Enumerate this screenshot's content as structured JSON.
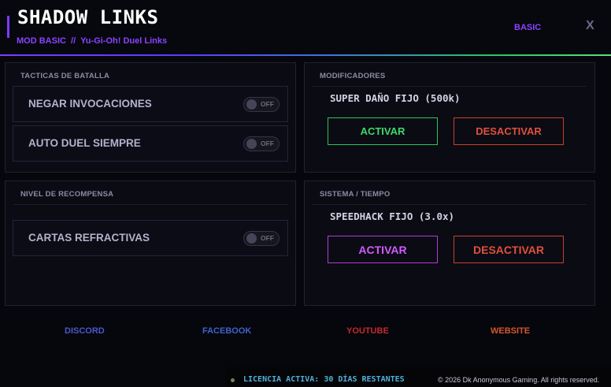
{
  "header": {
    "title": "SHADOW LINKS",
    "subtitle": "MOD BASIC  //  Yu-Gi-Oh! Duel Links",
    "mode": "BASIC",
    "close": "X"
  },
  "panels": {
    "battle": {
      "title": "TACTICAS DE BATALLA",
      "toggles": [
        {
          "label": "NEGAR INVOCACIONES",
          "state": "OFF"
        },
        {
          "label": "AUTO DUEL SIEMPRE",
          "state": "OFF"
        }
      ]
    },
    "modifiers": {
      "title": "MODIFICADORES",
      "item": "SUPER DAÑO FIJO (500k)",
      "activate": "ACTIVAR",
      "deactivate": "DESACTIVAR"
    },
    "reward": {
      "title": "NIVEL DE RECOMPENSA",
      "toggles": [
        {
          "label": "CARTAS REFRACTIVAS",
          "state": "OFF"
        }
      ]
    },
    "system": {
      "title": "SISTEMA / TIEMPO",
      "item": "SPEEDHACK FIJO (3.0x)",
      "activate": "ACTIVAR",
      "deactivate": "DESACTIVAR"
    }
  },
  "footer": {
    "links": [
      {
        "label": "DISCORD",
        "color": "#4c57c8"
      },
      {
        "label": "FACEBOOK",
        "color": "#3e63c9"
      },
      {
        "label": "YOUTUBE",
        "color": "#c42a2a"
      },
      {
        "label": "WEBSITE",
        "color": "#d6582a"
      }
    ],
    "status": "LICENCIA ACTIVA: 30 DÍAS RESTANTES",
    "copyright": "© 2026 Dk Anonymous Gaming. All rights reserved."
  },
  "colors": {
    "accent": "#8a44ff",
    "activate_green": "#3ed86a",
    "deactivate_red": "#e0503c",
    "activate_purple": "#d25bff"
  }
}
